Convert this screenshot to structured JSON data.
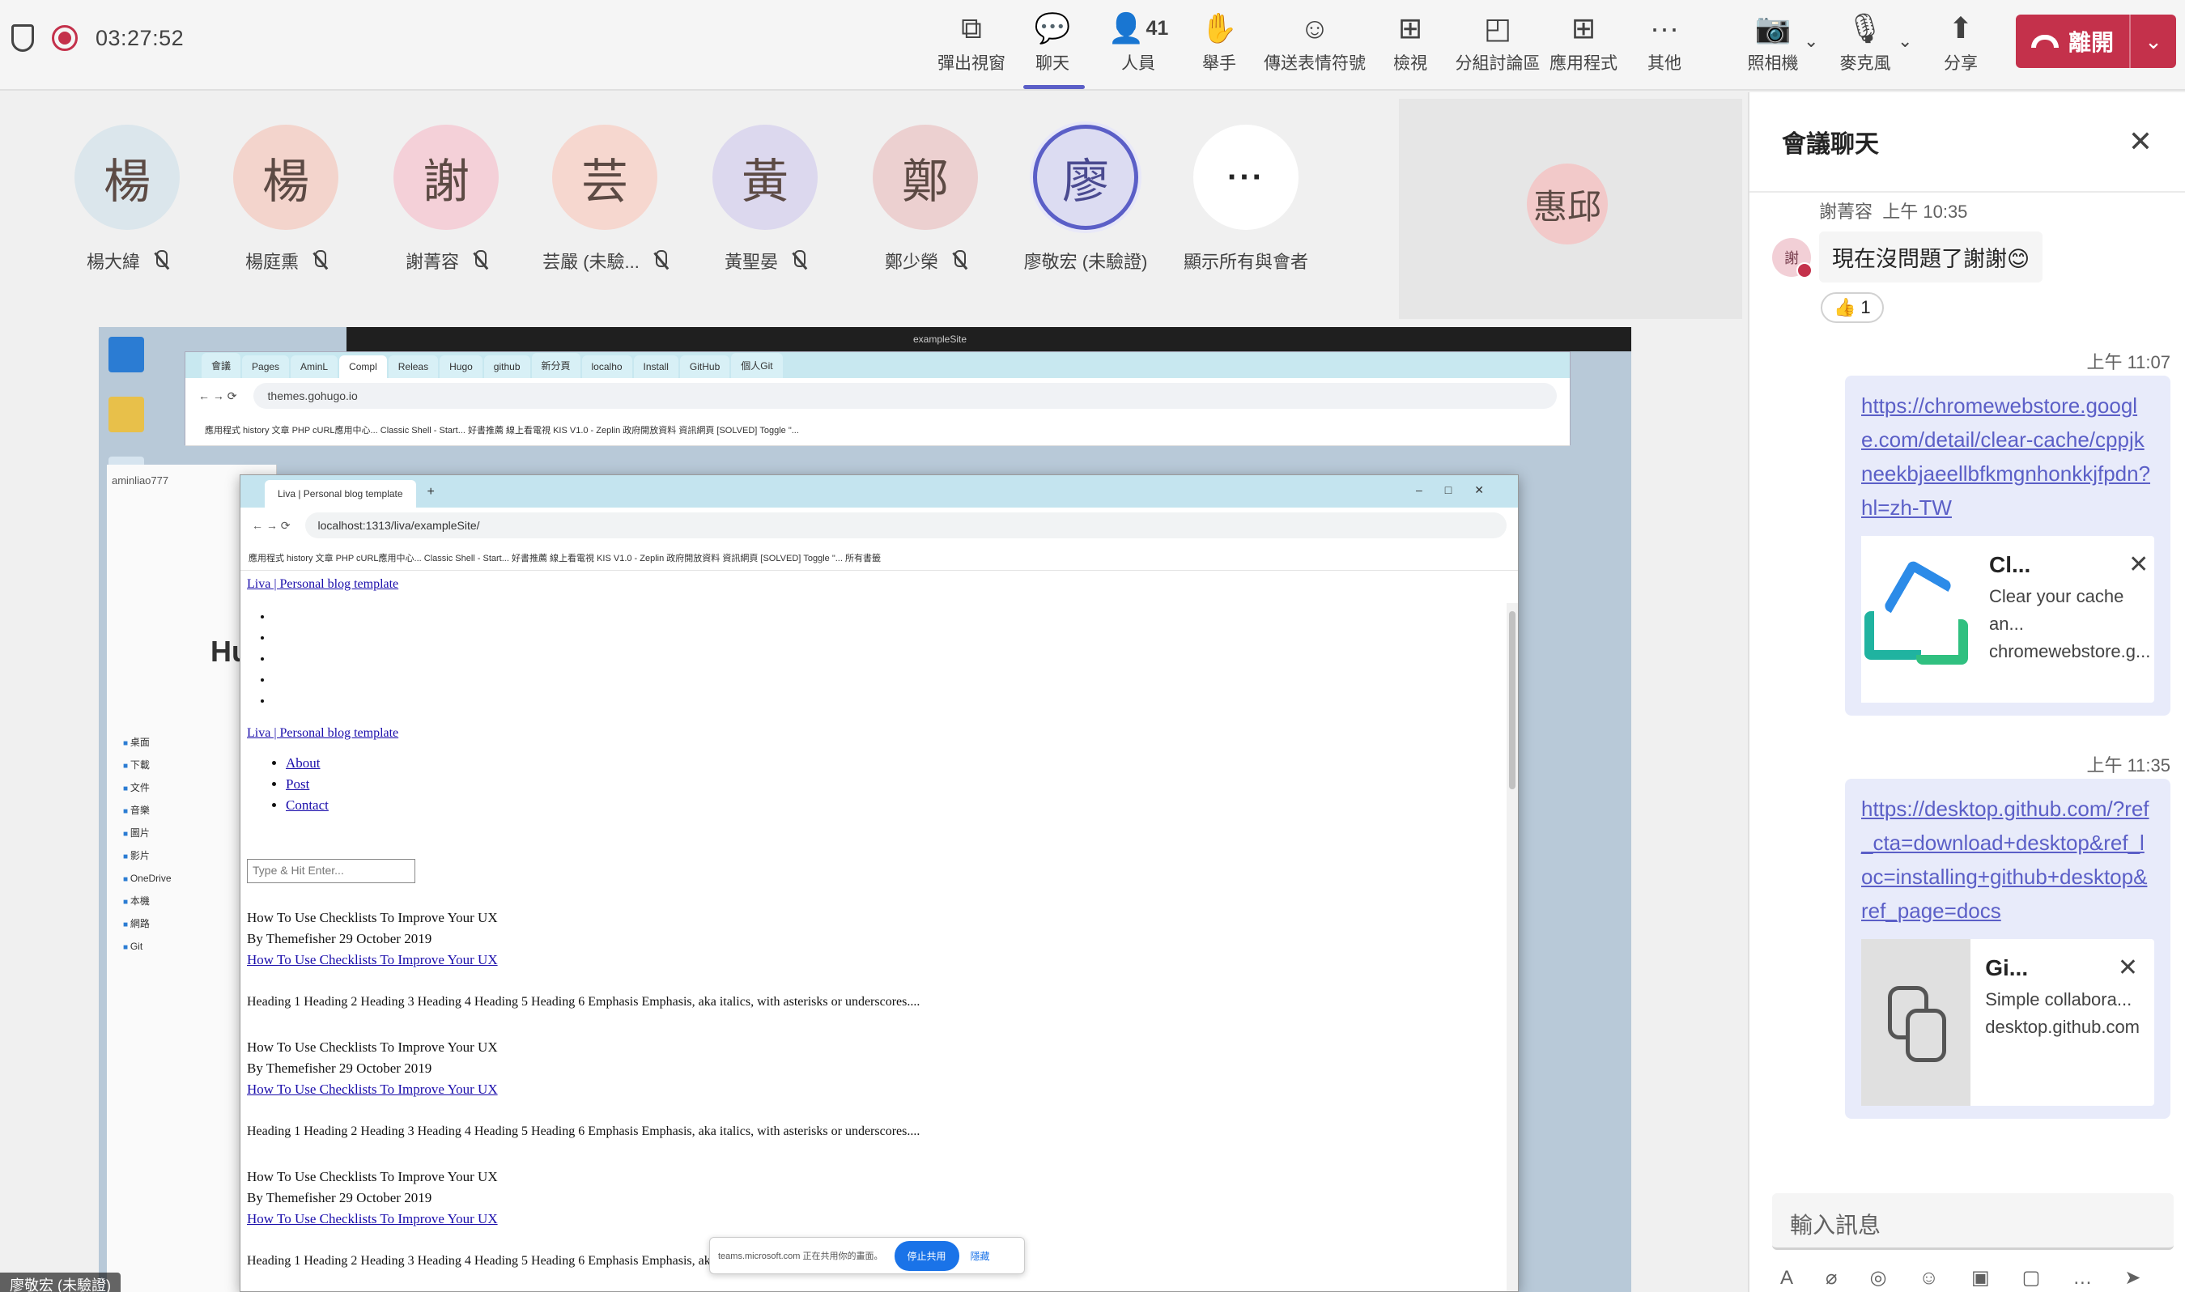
{
  "topbar": {
    "timer": "03:27:52",
    "buttons": {
      "popout": "彈出視窗",
      "chat": "聊天",
      "people": "人員",
      "people_count": "41",
      "raise_hand": "舉手",
      "reactions": "傳送表情符號",
      "view": "檢視",
      "breakout": "分組討論區",
      "apps": "應用程式",
      "more": "其他",
      "camera": "照相機",
      "mic": "麥克風",
      "share": "分享"
    },
    "leave_label": "離開"
  },
  "participants": [
    {
      "initial": "楊",
      "name": "楊大緯",
      "color": "#dbe6ec"
    },
    {
      "initial": "楊",
      "name": "楊庭熏",
      "color": "#f3d4cc"
    },
    {
      "initial": "謝",
      "name": "謝菁容",
      "color": "#f4d0d8"
    },
    {
      "initial": "芸",
      "name": "芸嚴 (未驗...",
      "color": "#f6d7cf"
    },
    {
      "initial": "黃",
      "name": "黃聖晏",
      "color": "#dcd8ee"
    },
    {
      "initial": "鄭",
      "name": "鄭少榮",
      "color": "#ecd0d0"
    },
    {
      "initial": "廖",
      "name": "廖敬宏 (未驗證)",
      "color": "#dcdcf2"
    },
    {
      "initial": "···",
      "name": "顯示所有與會者"
    }
  ],
  "video_tile": {
    "initial": "惠邱"
  },
  "shared_screen": {
    "presenter_badge": "廖敬宏 (未驗證)",
    "explorer_title": "aminliao777",
    "explorer_tree": [
      "桌面",
      "下載",
      "文件",
      "音樂",
      "圖片",
      "影片",
      "OneDrive",
      "本機",
      "網路",
      "Git"
    ],
    "side_heading": "Hu",
    "vscode_search": "exampleSite",
    "back_tabs": [
      "會議",
      "Pages",
      "AminL",
      "Compl",
      "Releas",
      "Hugo",
      "github",
      "新分頁",
      "localho",
      "Install",
      "GitHub",
      "個人Git"
    ],
    "back_url": "themes.gohugo.io",
    "back_bookmarks": "應用程式   history   文章   PHP cURL應用中心...   Classic Shell - Start...   好書推薦   線上看電視   KIS V1.0 - Zeplin   政府開放資料   資訊網頁   [SOLVED] Toggle \"...",
    "front_tab": "Liva | Personal blog template",
    "front_url": "localhost:1313/liva/exampleSite/",
    "front_bookmarks": "應用程式   history   文章   PHP cURL應用中心...   Classic Shell - Start...   好書推薦   線上看電視   KIS V1.0 - Zeplin   政府開放資料   資訊網頁   [SOLVED] Toggle \"...   所有書籤",
    "page": {
      "logo_alt": "Liva | Personal blog template",
      "nav": [
        "About",
        "Post",
        "Contact"
      ],
      "search_placeholder": "Type & Hit Enter...",
      "post_img_alt": "How To Use Checklists To Improve Your UX",
      "post_meta": "By Themefisher 29 October 2019",
      "post_link": "How To Use Checklists To Improve Your UX",
      "excerpt": "Heading 1 Heading 2 Heading 3 Heading 4 Heading 5 Heading 6 Emphasis Emphasis, aka italics, with asterisks or underscores...."
    },
    "sharebar": {
      "text": "teams.microsoft.com 正在共用你的畫面。",
      "stop": "停止共用",
      "hide": "隱藏"
    }
  },
  "chat": {
    "title": "會議聊天",
    "msg1": {
      "sender": "謝菁容",
      "time": "上午 10:35",
      "avatar": "謝",
      "text": "現在沒問題了謝謝😊",
      "reaction": "👍",
      "reaction_count": "1"
    },
    "msg2": {
      "time": "上午 11:07",
      "link": "https://chromewebstore.google.com/detail/clear-cache/cppjkneekbjaeellbfkmgnhonkkjfpdn?hl=zh-TW",
      "card_title": "Cl...",
      "card_desc": "Clear your cache an... chromewebstore.g..."
    },
    "msg3": {
      "time": "上午 11:35",
      "link": "https://desktop.github.com/?ref_cta=download+desktop&ref_loc=installing+github+desktop&ref_page=docs",
      "card_title": "Gi...",
      "card_desc": "Simple collabora... desktop.github.com"
    },
    "compose_placeholder": "輸入訊息"
  },
  "colors": {
    "accent": "#5b5fc7",
    "leave": "#c4314b"
  }
}
